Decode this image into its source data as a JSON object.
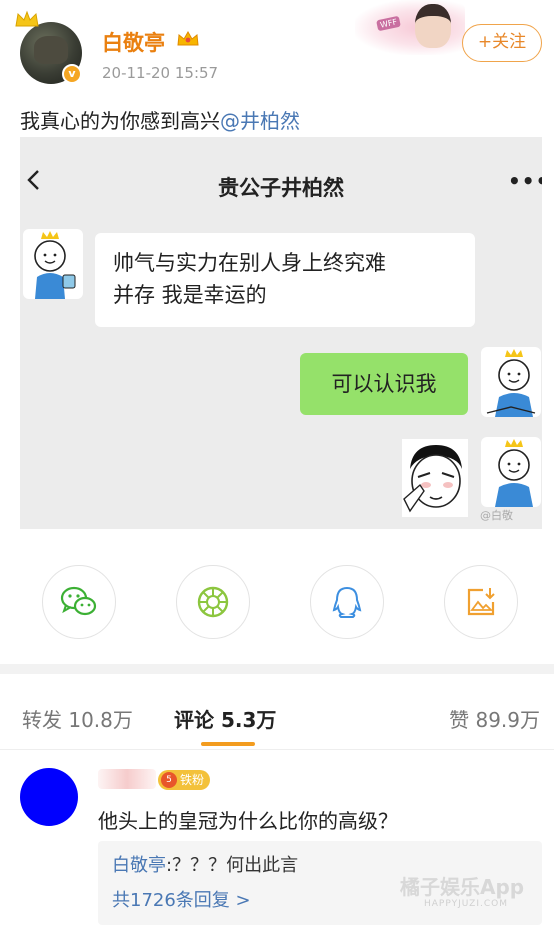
{
  "post": {
    "username": "白敬亭",
    "timestamp": "20-11-20 15:57",
    "follow_label": "+关注",
    "text_main": "我真心的为你感到高兴",
    "text_mention": "@井柏然"
  },
  "chat": {
    "title": "贵公子井柏然",
    "more_label": "•••",
    "received_line1": "帅气与实力在别人身上终究难",
    "received_line2": "并存 我是幸运的",
    "sent": "可以认识我",
    "watermark": "@白敬"
  },
  "share": {
    "items": [
      "wechat-icon",
      "moments-icon",
      "qq-icon",
      "save-image-icon"
    ],
    "colors": {
      "wechat": "#3cb034",
      "moments": "#8cc63f",
      "qq": "#3d8fe0",
      "save": "#f0a030"
    }
  },
  "tabs": {
    "repost": "转发 10.8万",
    "comment": "评论 5.3万",
    "like": "赞 89.9万"
  },
  "comment": {
    "badge": "铁粉",
    "badge_level": "5",
    "text": "他头上的皇冠为什么比你的高级？",
    "reply_user": "白敬亭",
    "reply_text": ":？？？何出此言",
    "reply_count": "共1726条回复 >"
  },
  "watermark": {
    "brand": "橘子娱乐App",
    "url": "HAPPYJUZI.COM"
  },
  "colors": {
    "accent_orange": "#ea8010",
    "link_blue": "#4a78b4",
    "bubble_green": "#95e16a",
    "commenter_avatar": "#0000ff"
  }
}
